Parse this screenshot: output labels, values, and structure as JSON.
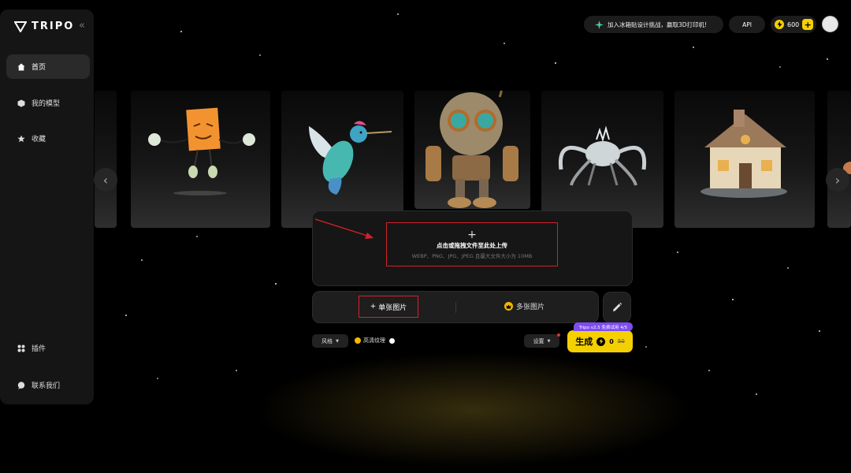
{
  "brand": {
    "name": "TRIPO",
    "accent": "#f5d000"
  },
  "sidebar": {
    "collapse_icon": "double-chevron-left-icon",
    "items": [
      {
        "label": "首页",
        "icon": "home-icon",
        "active": true
      },
      {
        "label": "我的模型",
        "icon": "cube-icon",
        "active": false
      },
      {
        "label": "收藏",
        "icon": "star-icon",
        "active": false
      }
    ],
    "footer_items": [
      {
        "label": "插件",
        "icon": "plugin-icon"
      },
      {
        "label": "联系我们",
        "icon": "chat-icon"
      }
    ]
  },
  "topbar": {
    "promo_label": "加入冰箱贴设计挑战，赢取3D打印机!",
    "api_label": "API",
    "credits": "600"
  },
  "gallery": {
    "items": [
      "box-character",
      "hummingbird",
      "rusty-robot",
      "spider-creature",
      "cottage-house"
    ]
  },
  "upload": {
    "plus": "+",
    "title": "点击或拖拽文件至此处上传",
    "hint": "WEBP、PNG、JPG、JPEG 且最大文件大小为 10MB"
  },
  "mode_tabs": {
    "single_label": "单张图片",
    "multi_label": "多张图片"
  },
  "controls": {
    "style_label": "风格",
    "hd_texture_label": "高清纹理",
    "settings_label": "设置",
    "trial_badge": "Tripo v2.5 免费试用 4/5",
    "generate_label": "生成",
    "cost_now": "0",
    "cost_old": "50"
  }
}
